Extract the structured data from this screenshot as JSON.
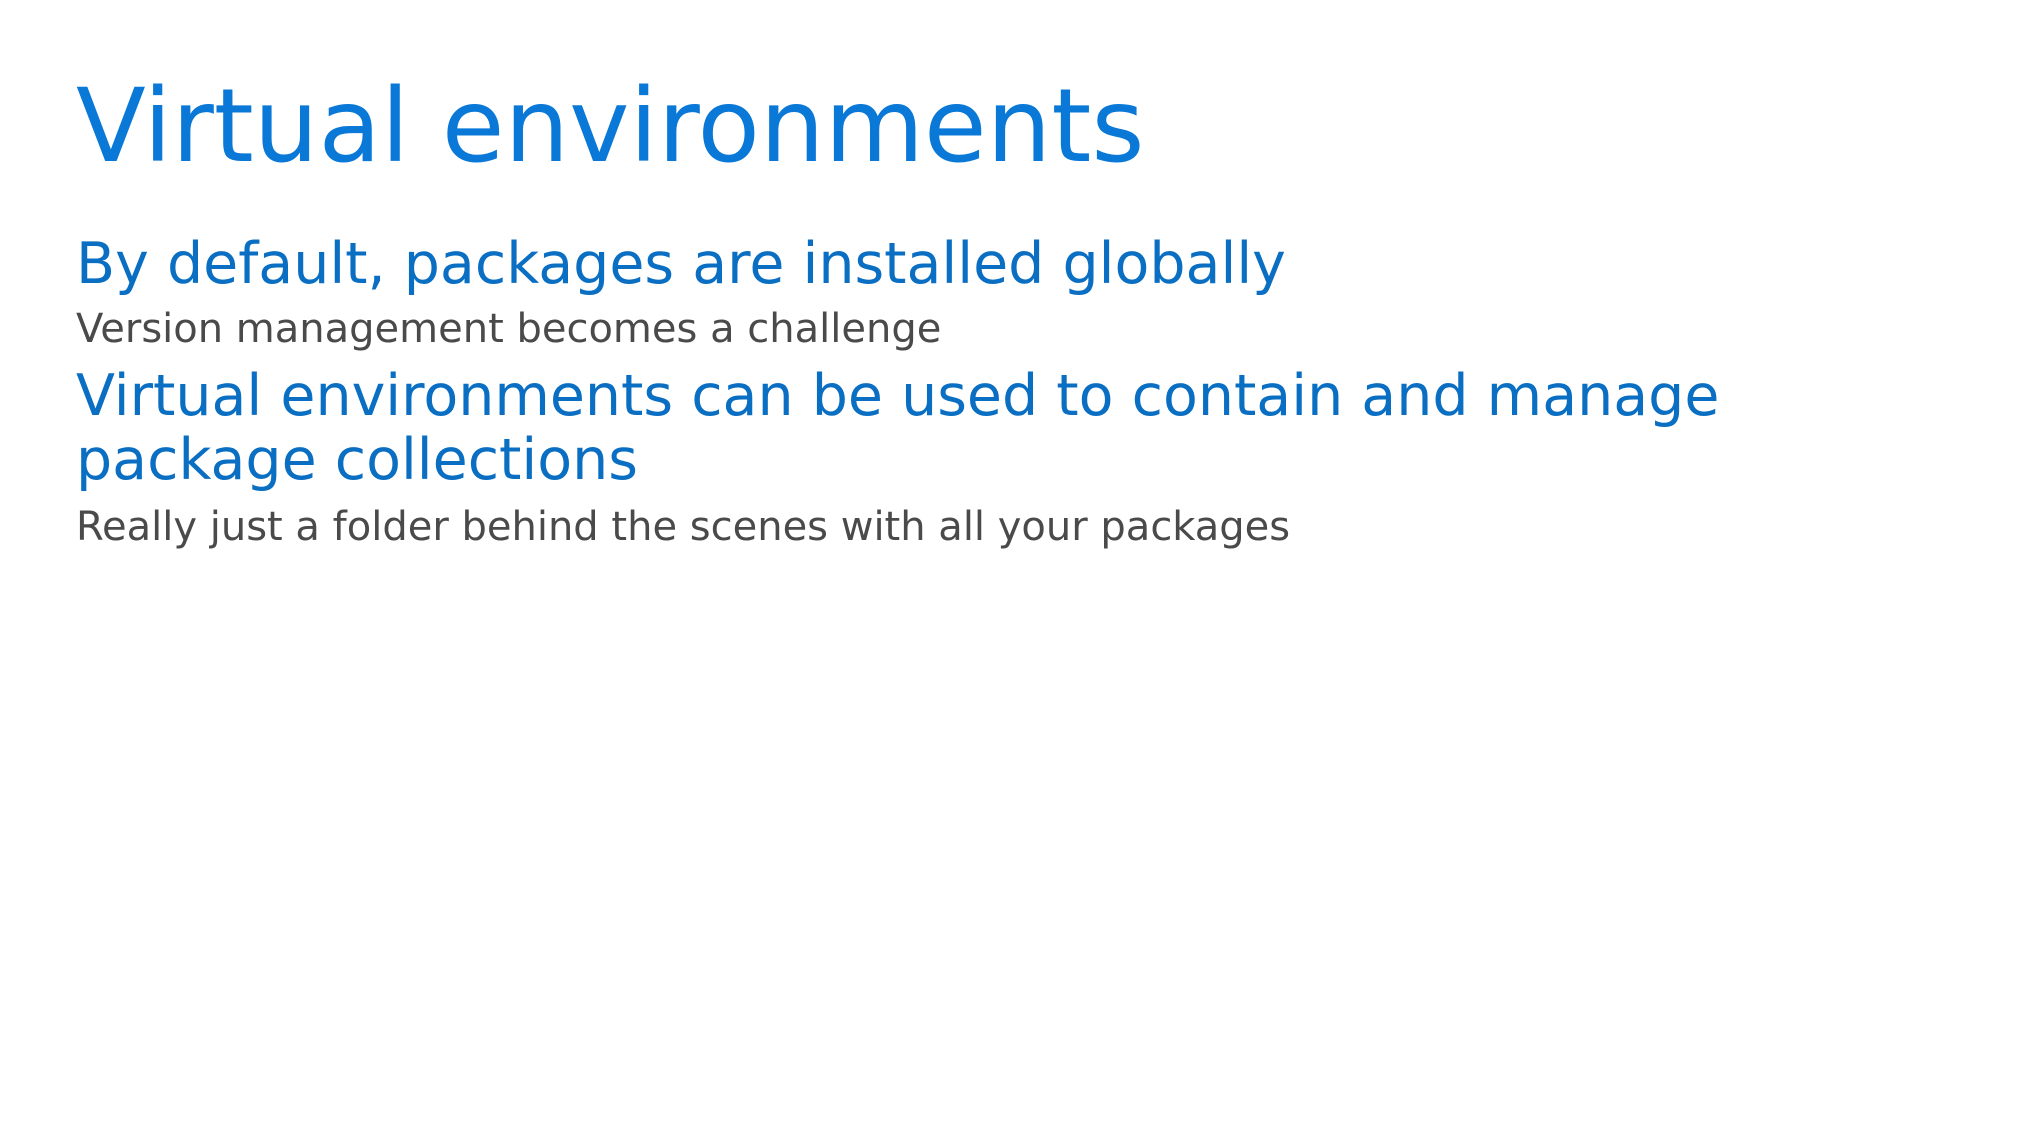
{
  "slide": {
    "title": "Virtual environments",
    "bullets": [
      {
        "text": "By default, packages are installed globally",
        "sub": "Version management becomes a challenge"
      },
      {
        "text": "Virtual environments can be used to contain and manage package collections",
        "sub": "Really just a folder behind the scenes with all your packages"
      }
    ]
  },
  "colors": {
    "title": "#0A78D7",
    "bullet": "#0A6FC2",
    "sub_bullet": "#4A4A4A",
    "background": "#FFFFFF"
  }
}
